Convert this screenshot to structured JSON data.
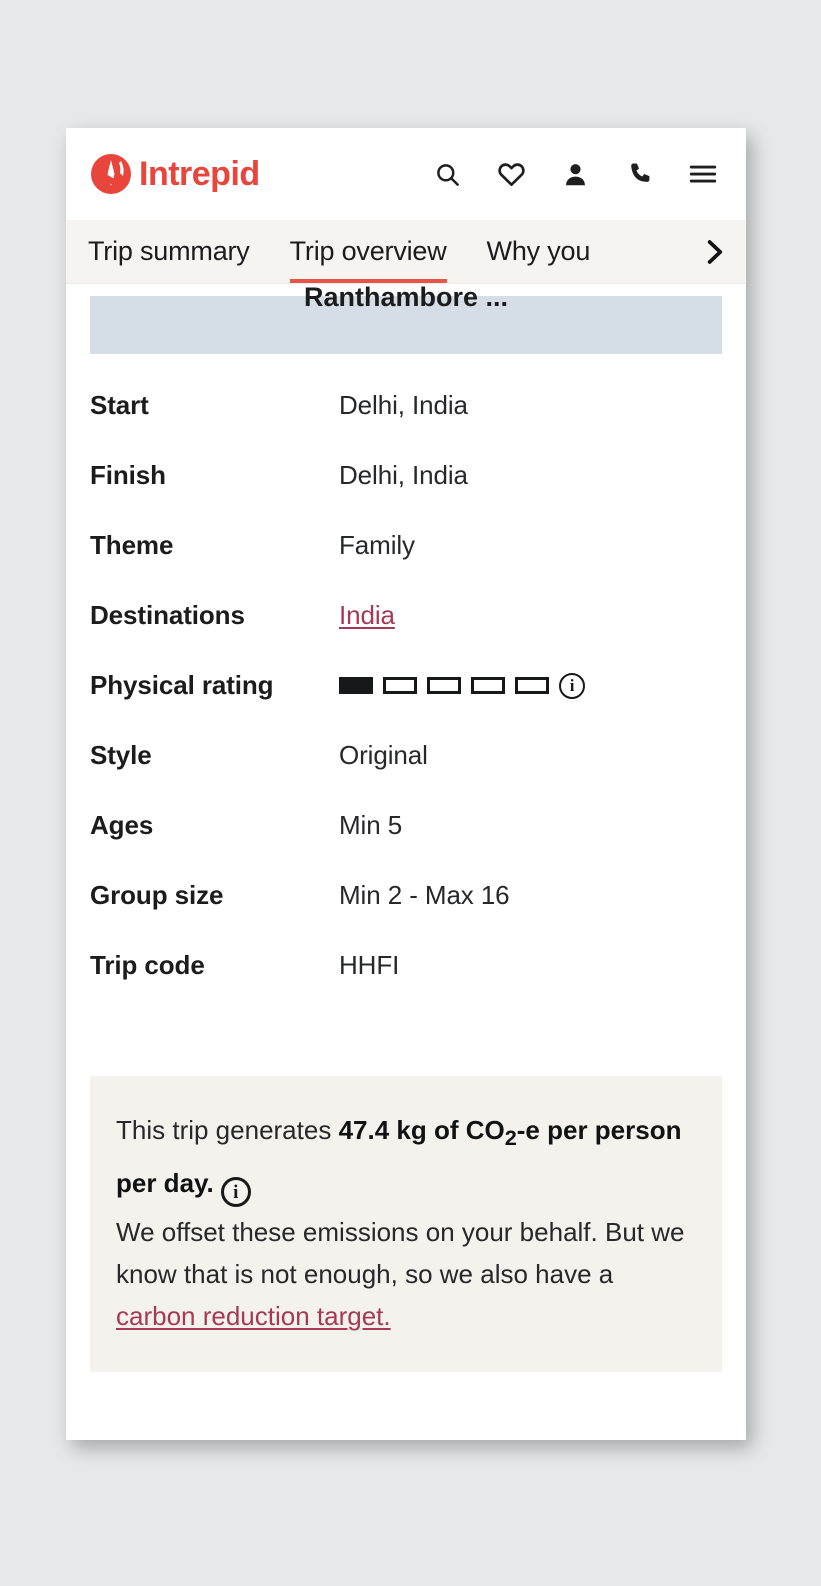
{
  "header": {
    "brand_name": "Intrepid",
    "brand_color": "#e8453c",
    "icons": [
      {
        "name": "search-icon",
        "label": "Search"
      },
      {
        "name": "heart-icon",
        "label": "Wishlist"
      },
      {
        "name": "person-icon",
        "label": "Account"
      },
      {
        "name": "phone-icon",
        "label": "Call us"
      },
      {
        "name": "hamburger-menu-icon",
        "label": "Menu"
      }
    ]
  },
  "tabs": {
    "items": [
      {
        "label": "Trip summary",
        "active": false
      },
      {
        "label": "Trip overview",
        "active": true
      },
      {
        "label": "Why you",
        "active": false
      }
    ],
    "next_icon": "chevron-right-icon",
    "active_underline_color": "#e8544a"
  },
  "content": {
    "clipped_heading": "Ranthambore ...",
    "details": [
      {
        "label": "Start",
        "value": "Delhi, India",
        "type": "text"
      },
      {
        "label": "Finish",
        "value": "Delhi, India",
        "type": "text"
      },
      {
        "label": "Theme",
        "value": "Family",
        "type": "text"
      },
      {
        "label": "Destinations",
        "value": "India",
        "type": "link"
      },
      {
        "label": "Physical rating",
        "value": "1",
        "type": "rating"
      },
      {
        "label": "Style",
        "value": "Original",
        "type": "text"
      },
      {
        "label": "Ages",
        "value": "Min 5",
        "type": "text"
      },
      {
        "label": "Group size",
        "value": "Min 2 - Max 16",
        "type": "text"
      },
      {
        "label": "Trip code",
        "value": "HHFI",
        "type": "text"
      }
    ],
    "physical_rating": {
      "filled": 1,
      "total": 5,
      "info_glyph": "i"
    }
  },
  "carbon": {
    "lead_prefix": "This trip generates ",
    "highlight_1": "47.4 kg of CO",
    "highlight_sub": "2",
    "highlight_2": "-e per person per day.",
    "highlight_color": "#f0b84a",
    "info_glyph": "i",
    "body_prefix": "We offset these emissions on your behalf. But we know that is not enough, so we also have a ",
    "body_link": "carbon reduction target.",
    "link_color": "#a63a55"
  }
}
